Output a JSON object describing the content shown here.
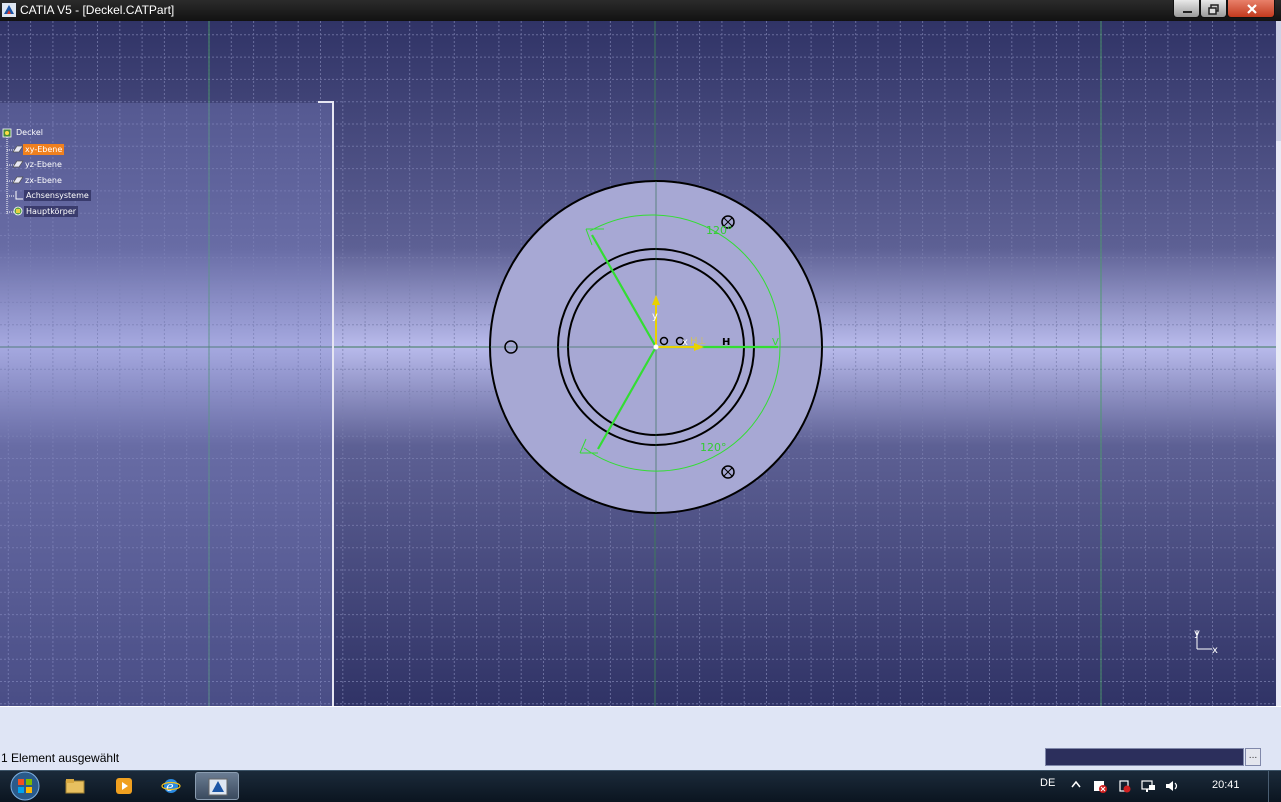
{
  "window": {
    "title": "CATIA V5 - [Deckel.CATPart]"
  },
  "tree": {
    "root": "Deckel",
    "items": [
      {
        "label": "xy-Ebene",
        "selected": true
      },
      {
        "label": "yz-Ebene",
        "selected": false
      },
      {
        "label": "zx-Ebene",
        "selected": false
      },
      {
        "label": "Achsensysteme",
        "selected": false
      },
      {
        "label": "Hauptkörper",
        "selected": false
      }
    ]
  },
  "sketch": {
    "angle_top": "120°",
    "angle_bottom": "120°",
    "axis_v": "V",
    "axis_h": "H",
    "sketch_axis_x": "x",
    "sketch_axis_y": "y",
    "compass_x": "x",
    "compass_y": "y",
    "construction_color": "#33cc33",
    "profile_color": "#000000"
  },
  "statusbar": {
    "message": "1 Element ausgewählt",
    "command_value": "",
    "command_button": "..."
  },
  "taskbar": {
    "language": "DE",
    "time": "20:41"
  }
}
